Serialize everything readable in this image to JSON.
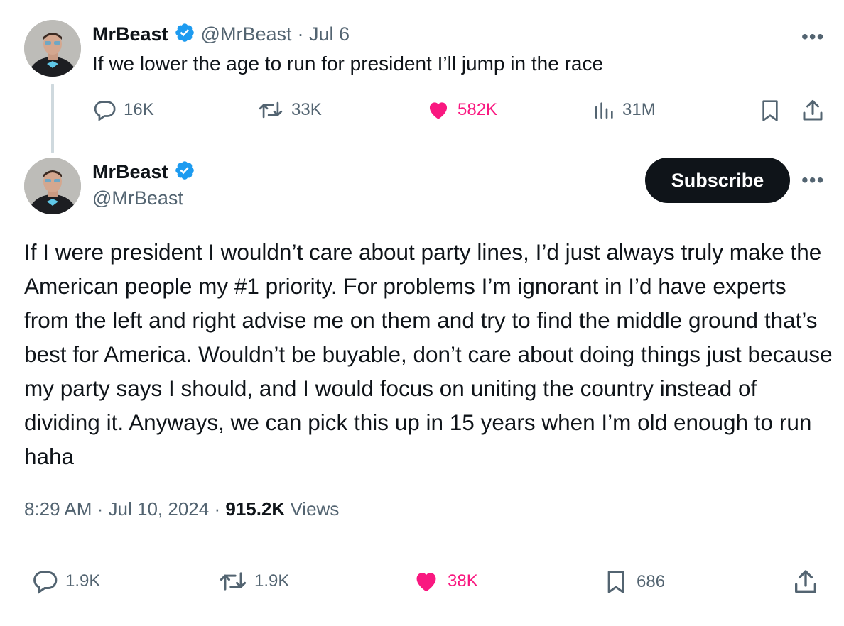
{
  "parent_tweet": {
    "author_name": "MrBeast",
    "handle": "@MrBeast",
    "date": "· Jul 6",
    "text": "If we lower the age to run for president I’ll jump in the race",
    "stats": {
      "replies": "16K",
      "retweets": "33K",
      "likes": "582K",
      "views": "31M"
    }
  },
  "main_tweet": {
    "author_name": "MrBeast",
    "handle": "@MrBeast",
    "subscribe_label": "Subscribe",
    "text": "If I were president I wouldn’t care about party lines, I’d just always truly make the American people my #1 priority. For problems I’m ignorant in I’d have experts from the left and right advise me on them and try to find the middle ground that’s best for America. Wouldn’t be buyable, don’t care about doing things just because my party says I should, and I would focus on uniting the country instead of dividing it. Anyways, we can pick this up in 15 years when I’m old enough to run haha",
    "time": "8:29 AM",
    "sep1": "·",
    "date": "Jul 10, 2024",
    "sep2": "·",
    "views_count": "915.2K",
    "views_label": "Views",
    "stats": {
      "replies": "1.9K",
      "retweets": "1.9K",
      "likes": "38K",
      "bookmarks": "686"
    }
  },
  "more_glyph": "•••",
  "colors": {
    "like": "#f91880",
    "verified": "#1d9bf0",
    "secondary": "#536471",
    "primary": "#0f1419"
  }
}
